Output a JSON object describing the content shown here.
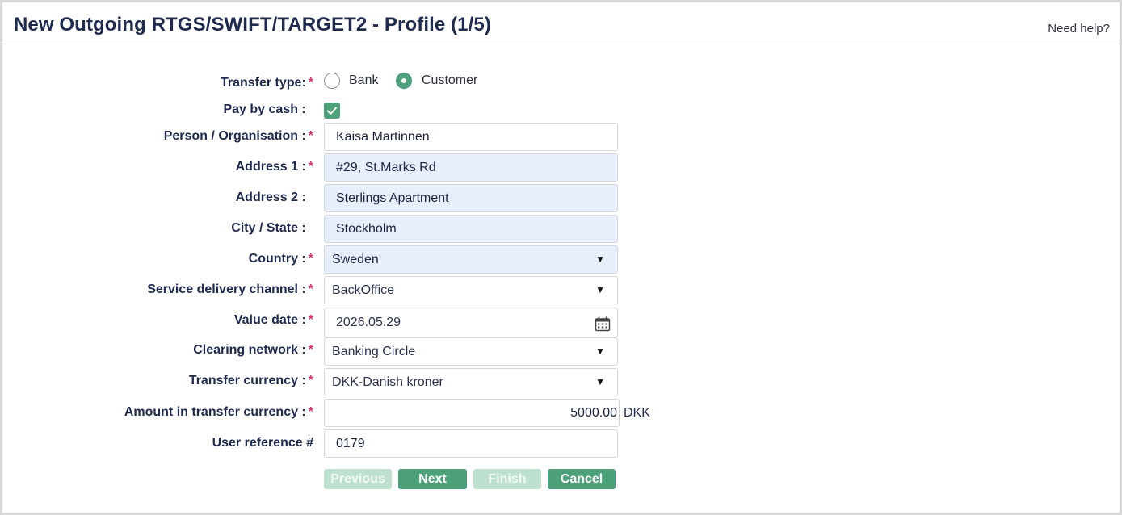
{
  "header": {
    "title": "New Outgoing RTGS/SWIFT/TARGET2 - Profile (1/5)",
    "help": "Need help?"
  },
  "form": {
    "transfer_type": {
      "label": "Transfer type:",
      "required": "*",
      "options": [
        "Bank",
        "Customer"
      ],
      "selected": "Customer"
    },
    "pay_by_cash": {
      "label": "Pay by cash :",
      "checked": true
    },
    "person": {
      "label": "Person / Organisation :",
      "required": "*",
      "value": "Kaisa Martinnen"
    },
    "address1": {
      "label": "Address 1 :",
      "required": "*",
      "value": "#29, St.Marks Rd"
    },
    "address2": {
      "label": "Address 2 :",
      "value": "Sterlings Apartment"
    },
    "city": {
      "label": "City / State :",
      "value": "Stockholm"
    },
    "country": {
      "label": "Country :",
      "required": "*",
      "value": "Sweden"
    },
    "service_channel": {
      "label": "Service delivery channel :",
      "required": "*",
      "value": "BackOffice"
    },
    "value_date": {
      "label": "Value date :",
      "required": "*",
      "value": "2026.05.29"
    },
    "clearing_network": {
      "label": "Clearing network :",
      "required": "*",
      "value": "Banking Circle"
    },
    "transfer_currency": {
      "label": "Transfer currency :",
      "required": "*",
      "value": "DKK-Danish kroner"
    },
    "amount": {
      "label": "Amount in transfer currency :",
      "required": "*",
      "value": "5000.00",
      "unit": "DKK"
    },
    "user_reference": {
      "label": "User reference #",
      "value": "0179"
    }
  },
  "buttons": {
    "previous": "Previous",
    "next": "Next",
    "finish": "Finish",
    "cancel": "Cancel"
  },
  "colors": {
    "accent": "#4ca07a",
    "accent_disabled": "#bde0cf",
    "required": "#d6336c",
    "filled_field": "#e8effc",
    "title": "#1f2a4f"
  }
}
